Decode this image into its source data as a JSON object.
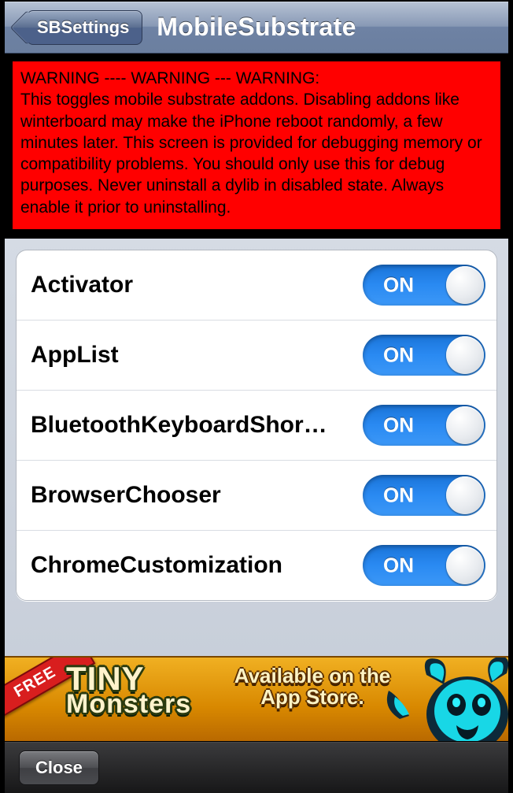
{
  "navbar": {
    "back_label": "SBSettings",
    "title": "MobileSubstrate"
  },
  "warning": "WARNING ---- WARNING --- WARNING:\nThis toggles mobile substrate addons. Disabling addons like winterboard may make the iPhone reboot randomly, a few minutes later. This screen is provided for debugging memory or compatibility problems. You should only use this for debug purposes. Never uninstall a dylib in disabled state. Always enable it prior to uninstalling.",
  "toggle_on_label": "ON",
  "addons": [
    {
      "name": "Activator",
      "enabled": true
    },
    {
      "name": "AppList",
      "enabled": true
    },
    {
      "name": "BluetoothKeyboardShortcuts",
      "enabled": true
    },
    {
      "name": "BrowserChooser",
      "enabled": true
    },
    {
      "name": "ChromeCustomization",
      "enabled": true
    }
  ],
  "ad": {
    "free_badge": "FREE",
    "game_line1": "TINY",
    "game_line2": "Monsters",
    "avail_text": "Available on the App Store."
  },
  "bottombar": {
    "close_label": "Close"
  }
}
